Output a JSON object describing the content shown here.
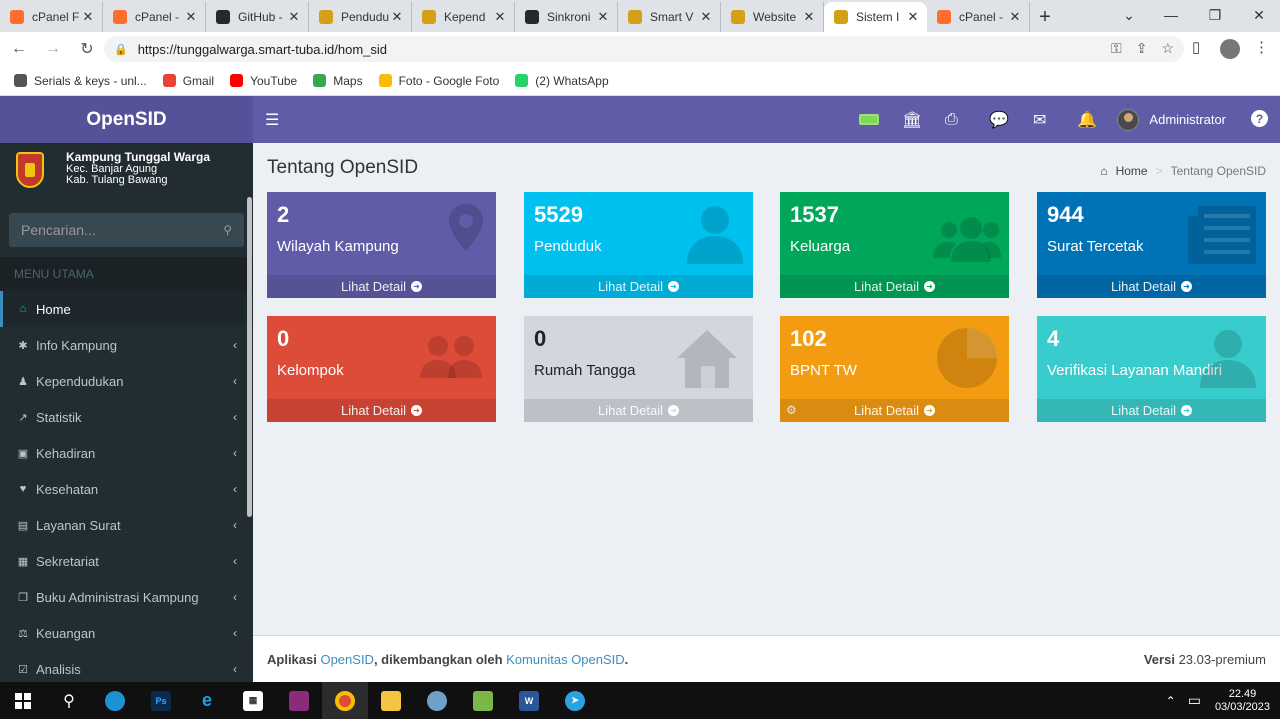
{
  "browser": {
    "tabs": [
      {
        "title": "cPanel F",
        "color": "#ff6c2c",
        "icon": "cpanel-icon"
      },
      {
        "title": "cPanel -",
        "color": "#ff6c2c",
        "icon": "cpanel-icon"
      },
      {
        "title": "GitHub -",
        "color": "#24292e",
        "icon": "github-icon"
      },
      {
        "title": "Pendudu",
        "color": "#d4a017",
        "icon": "opensid-icon"
      },
      {
        "title": "Kepend",
        "color": "#d4a017",
        "icon": "opensid-icon"
      },
      {
        "title": "Sinkroni",
        "color": "#24292e",
        "icon": "github-icon"
      },
      {
        "title": "Smart V",
        "color": "#d4a017",
        "icon": "opensid-icon"
      },
      {
        "title": "Website",
        "color": "#d4a017",
        "icon": "opensid-icon"
      },
      {
        "title": "Sistem I",
        "color": "#d4a017",
        "icon": "opensid-icon",
        "active": true
      },
      {
        "title": "cPanel -",
        "color": "#ff6c2c",
        "icon": "cpanel-icon"
      }
    ],
    "url": "https://tunggalwarga.smart-tuba.id/hom_sid",
    "bookmarks": [
      {
        "label": "Serials & keys - unl...",
        "color": "#555",
        "icon": "globe-icon"
      },
      {
        "label": "Gmail",
        "color": "#ea4335",
        "icon": "gmail-icon"
      },
      {
        "label": "YouTube",
        "color": "#ff0000",
        "icon": "youtube-icon"
      },
      {
        "label": "Maps",
        "color": "#34a853",
        "icon": "maps-icon"
      },
      {
        "label": "Foto - Google Foto",
        "color": "#fbbc05",
        "icon": "photos-icon"
      },
      {
        "label": "(2) WhatsApp",
        "color": "#25d366",
        "icon": "whatsapp-icon"
      }
    ]
  },
  "app": {
    "logo": "OpenSID",
    "village": {
      "name": "Kampung Tunggal Warga",
      "district": "Kec. Banjar Agung",
      "regency": "Kab. Tulang Bawang"
    },
    "search_placeholder": "Pencarian...",
    "menu_header": "MENU UTAMA",
    "menu": [
      {
        "label": "Home",
        "icon": "home-icon",
        "glyph": "⌂",
        "active": true
      },
      {
        "label": "Info Kampung",
        "icon": "info-icon",
        "glyph": "✱"
      },
      {
        "label": "Kependudukan",
        "icon": "users-icon",
        "glyph": "♟"
      },
      {
        "label": "Statistik",
        "icon": "chart-icon",
        "glyph": "↗"
      },
      {
        "label": "Kehadiran",
        "icon": "calendar-icon",
        "glyph": "▣"
      },
      {
        "label": "Kesehatan",
        "icon": "heart-icon",
        "glyph": "♥"
      },
      {
        "label": "Layanan Surat",
        "icon": "book-icon",
        "glyph": "▤"
      },
      {
        "label": "Sekretariat",
        "icon": "archive-icon",
        "glyph": "▦"
      },
      {
        "label": "Buku Administrasi Kampung",
        "icon": "files-icon",
        "glyph": "❐"
      },
      {
        "label": "Keuangan",
        "icon": "balance-icon",
        "glyph": "⚖"
      },
      {
        "label": "Analisis",
        "icon": "check-icon",
        "glyph": "☑"
      }
    ],
    "topnav": {
      "user": "Administrator"
    },
    "page_title": "Tentang OpenSID",
    "breadcrumb": {
      "home": "Home",
      "current": "Tentang OpenSID"
    },
    "boxes": [
      {
        "value": "2",
        "label": "Wilayah Kampung",
        "link": "Lihat Detail",
        "color": "#605ca8",
        "icon": "map-marker-icon"
      },
      {
        "value": "5529",
        "label": "Penduduk",
        "link": "Lihat Detail",
        "color": "#00c0ef",
        "icon": "user-icon"
      },
      {
        "value": "1537",
        "label": "Keluarga",
        "link": "Lihat Detail",
        "color": "#00a65a",
        "icon": "group-icon"
      },
      {
        "value": "944",
        "label": "Surat Tercetak",
        "link": "Lihat Detail",
        "color": "#0073b7",
        "icon": "newspaper-icon"
      },
      {
        "value": "0",
        "label": "Kelompok",
        "link": "Lihat Detail",
        "color": "#dd4b39",
        "icon": "people-icon"
      },
      {
        "value": "0",
        "label": "Rumah Tangga",
        "link": "Lihat Detail",
        "color": "#d2d6de",
        "icon": "house-icon"
      },
      {
        "value": "102",
        "label": "BPNT TW",
        "link": "Lihat Detail",
        "color": "#f39c12",
        "icon": "pie-chart-icon"
      },
      {
        "value": "4",
        "label": "Verifikasi Layanan Mandiri",
        "link": "Lihat Detail",
        "color": "#39cccc",
        "icon": "user-icon"
      }
    ],
    "footer": {
      "prefix": "Aplikasi ",
      "app_link": "OpenSID",
      "middle": ", dikembangkan oleh ",
      "community_link": "Komunitas OpenSID",
      "suffix": ".",
      "version_label": "Versi",
      "version": "23.03-premium"
    }
  },
  "taskbar": {
    "time": "22.49",
    "date": "03/03/2023"
  }
}
